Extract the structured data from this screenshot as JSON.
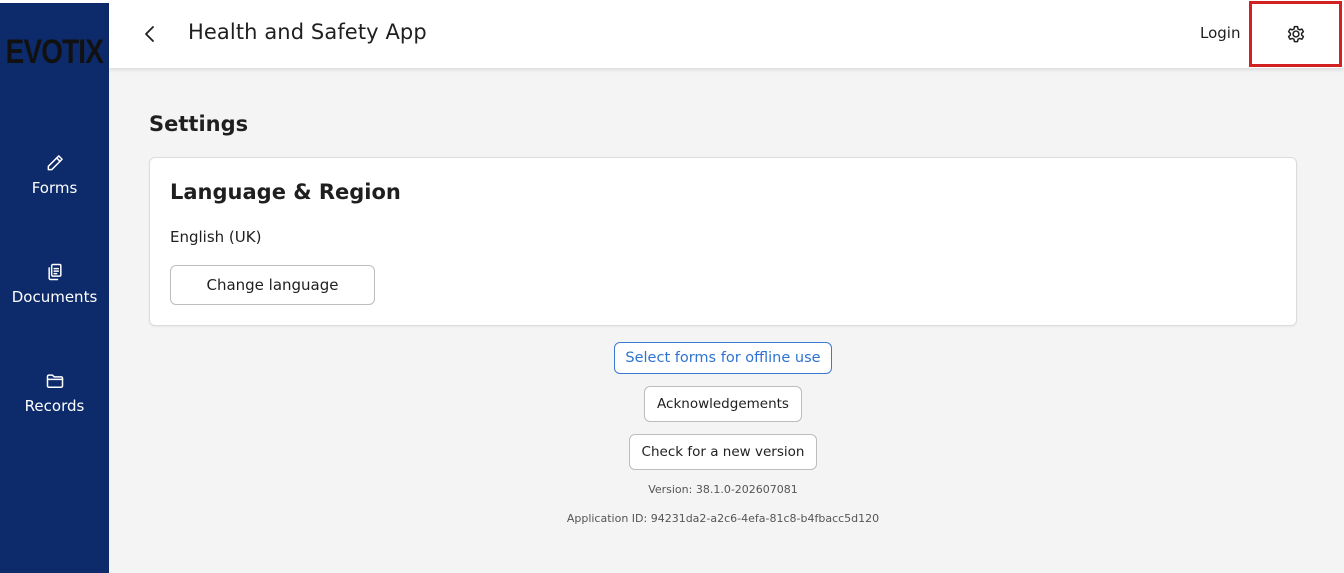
{
  "sidebar": {
    "logo_text": "EVOTIX",
    "items": [
      {
        "label": "Forms",
        "icon": "pencil-icon"
      },
      {
        "label": "Documents",
        "icon": "documents-icon"
      },
      {
        "label": "Records",
        "icon": "folder-icon"
      }
    ]
  },
  "header": {
    "title": "Health and Safety App",
    "login_label": "Login",
    "settings_icon": "gear-icon",
    "back_icon": "chevron-left-icon"
  },
  "main": {
    "page_title": "Settings",
    "language_card": {
      "title": "Language & Region",
      "current_language": "English (UK)",
      "change_button_label": "Change language"
    },
    "offline_button_label": "Select forms for offline use",
    "acknowledgements_button_label": "Acknowledgements",
    "check_version_button_label": "Check for a new version",
    "version_text": "Version: 38.1.0-202607081",
    "application_id_text": "Application ID: 94231da2-a2c6-4efa-81c8-b4fbacc5d120"
  },
  "colors": {
    "sidebar_bg": "#0d2b6b",
    "highlight_border": "#d32020",
    "link_blue": "#2f74d0",
    "main_bg": "#f4f4f4"
  }
}
